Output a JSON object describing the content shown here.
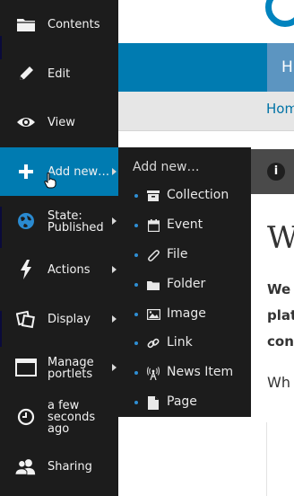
{
  "site": {
    "nav_home": "H",
    "breadcrumb_home": "Hom",
    "title_partial": "W",
    "text_lines": [
      "We",
      "plat",
      "con"
    ],
    "text_line_normal": "Wh"
  },
  "toolbar": {
    "items": [
      {
        "label": "Contents",
        "icon": "folder-icon",
        "has_arrow": false
      },
      {
        "label": "Edit",
        "icon": "pencil-icon",
        "has_arrow": false
      },
      {
        "label": "View",
        "icon": "eye-icon",
        "has_arrow": false
      },
      {
        "label": "Add new…",
        "icon": "plus-icon",
        "has_arrow": true
      },
      {
        "label": "State:\nPublished",
        "icon": "globe-icon",
        "has_arrow": true
      },
      {
        "label": "Actions",
        "icon": "lightning-icon",
        "has_arrow": true
      },
      {
        "label": "Display",
        "icon": "display-icon",
        "has_arrow": true
      },
      {
        "label": "Manage\nportlets",
        "icon": "window-icon",
        "has_arrow": true
      },
      {
        "label": "a few\nseconds\nago",
        "icon": "clock-icon",
        "has_arrow": false
      },
      {
        "label": "Sharing",
        "icon": "users-icon",
        "has_arrow": false
      }
    ]
  },
  "submenu": {
    "title": "Add new…",
    "items": [
      {
        "label": "Collection",
        "icon": "collection-icon"
      },
      {
        "label": "Event",
        "icon": "calendar-icon"
      },
      {
        "label": "File",
        "icon": "paperclip-icon"
      },
      {
        "label": "Folder",
        "icon": "folder-icon"
      },
      {
        "label": "Image",
        "icon": "image-icon"
      },
      {
        "label": "Link",
        "icon": "link-icon"
      },
      {
        "label": "News Item",
        "icon": "broadcast-icon"
      },
      {
        "label": "Page",
        "icon": "page-icon"
      }
    ]
  },
  "colors": {
    "toolbar_bg": "#1c1c1c",
    "active_bg": "#007bb1",
    "accent": "#0083be",
    "bullet": "#2f8fd4"
  }
}
